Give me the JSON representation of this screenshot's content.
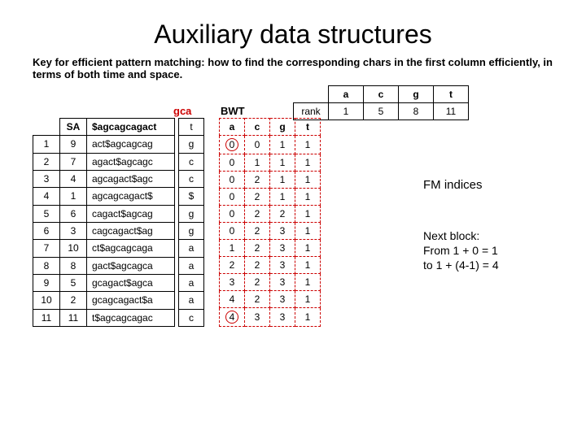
{
  "title": "Auxiliary data structures",
  "subtitle": "Key for efficient pattern matching: how to find the corresponding chars in the first column efficiently, in terms of both time and space.",
  "gca": "gca",
  "bwt_label": "BWT",
  "sa_header": "SA",
  "rot_header": "$agcagcagact",
  "rows": [
    {
      "i": "1",
      "sa": "9",
      "rot": "act$agcagcag",
      "bwt": "g"
    },
    {
      "i": "2",
      "sa": "7",
      "rot": "agact$agcagc",
      "bwt": "c"
    },
    {
      "i": "3",
      "sa": "4",
      "rot": "agcagact$agc",
      "bwt": "c"
    },
    {
      "i": "4",
      "sa": "1",
      "rot": "agcagcagact$",
      "bwt": "$"
    },
    {
      "i": "5",
      "sa": "6",
      "rot": "cagact$agcag",
      "bwt": "g"
    },
    {
      "i": "6",
      "sa": "3",
      "rot": "cagcagact$ag",
      "bwt": "g"
    },
    {
      "i": "7",
      "sa": "10",
      "rot": "ct$agcagcaga",
      "bwt": "a"
    },
    {
      "i": "8",
      "sa": "8",
      "rot": "gact$agcagca",
      "bwt": "a"
    },
    {
      "i": "9",
      "sa": "5",
      "rot": "gcagact$agca",
      "bwt": "a"
    },
    {
      "i": "10",
      "sa": "2",
      "rot": "gcagcagact$a",
      "bwt": "a"
    },
    {
      "i": "11",
      "sa": "11",
      "rot": "t$agcagcagac",
      "bwt": "c"
    }
  ],
  "bwt_head": "t",
  "fm_headers": [
    "a",
    "c",
    "g",
    "t"
  ],
  "fm_data": [
    [
      "0",
      "0",
      "1",
      "1"
    ],
    [
      "0",
      "1",
      "1",
      "1"
    ],
    [
      "0",
      "2",
      "1",
      "1"
    ],
    [
      "0",
      "2",
      "1",
      "1"
    ],
    [
      "0",
      "2",
      "2",
      "1"
    ],
    [
      "0",
      "2",
      "3",
      "1"
    ],
    [
      "1",
      "2",
      "3",
      "1"
    ],
    [
      "2",
      "2",
      "3",
      "1"
    ],
    [
      "3",
      "2",
      "3",
      "1"
    ],
    [
      "4",
      "2",
      "3",
      "1"
    ],
    [
      "4",
      "3",
      "3",
      "1"
    ]
  ],
  "rank_label": "rank",
  "rank_cols": [
    "a",
    "c",
    "g",
    "t"
  ],
  "rank_vals": [
    "1",
    "5",
    "8",
    "11"
  ],
  "fm_title": "FM indices",
  "next_block_1": "Next block:",
  "next_block_2": "From 1 + 0 = 1",
  "next_block_3": "to 1 + (4-1) = 4"
}
